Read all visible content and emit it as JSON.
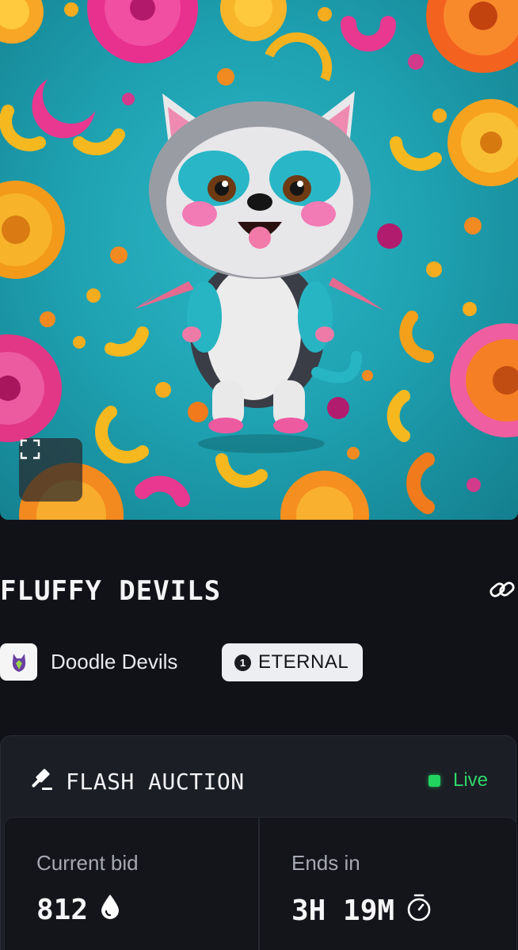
{
  "nft": {
    "title": "FLUFFY DEVILS",
    "collection": "Doodle Devils",
    "edition_number": "1",
    "edition_type": "ETERNAL"
  },
  "icons": {
    "fullscreen": "expand-corners-icon",
    "link": "chain-link-icon",
    "auction": "gavel-icon",
    "currency": "drop-icon",
    "timer": "stopwatch-icon"
  },
  "auction": {
    "title": "FLASH AUCTION",
    "status": "Live",
    "current_bid_label": "Current bid",
    "current_bid_value": "812",
    "ends_in_label": "Ends in",
    "ends_in_value": "3H 19M"
  },
  "colors": {
    "background": "#111217",
    "card": "#1c1e25",
    "live": "#22d35f",
    "badge": "#eceef1"
  }
}
